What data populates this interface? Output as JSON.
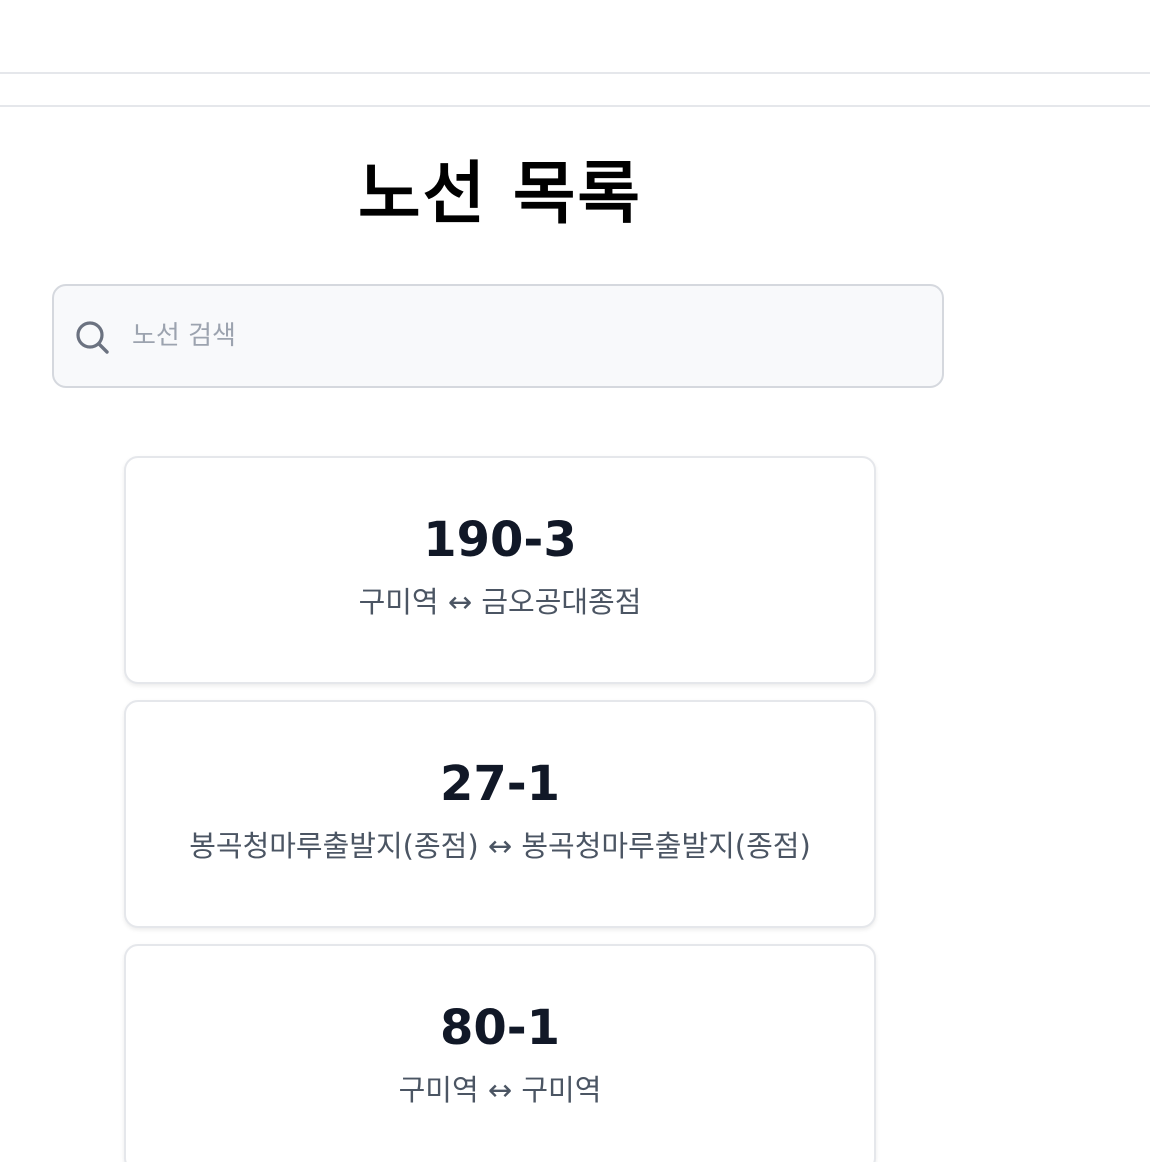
{
  "page": {
    "title": "노선 목록"
  },
  "search": {
    "placeholder": "노선 검색",
    "value": ""
  },
  "routes": [
    {
      "number": "190-3",
      "endpoints": "구미역 ↔ 금오공대종점"
    },
    {
      "number": "27-1",
      "endpoints": "봉곡청마루출발지(종점) ↔ 봉곡청마루출발지(종점)"
    },
    {
      "number": "80-1",
      "endpoints": "구미역 ↔ 구미역"
    }
  ],
  "colors": {
    "title": "#000000",
    "route_number": "#111827",
    "route_endpoints": "#4b5563",
    "search_background": "#f8f9fb",
    "border": "#e5e7eb"
  },
  "icons": {
    "search": "search-icon"
  }
}
